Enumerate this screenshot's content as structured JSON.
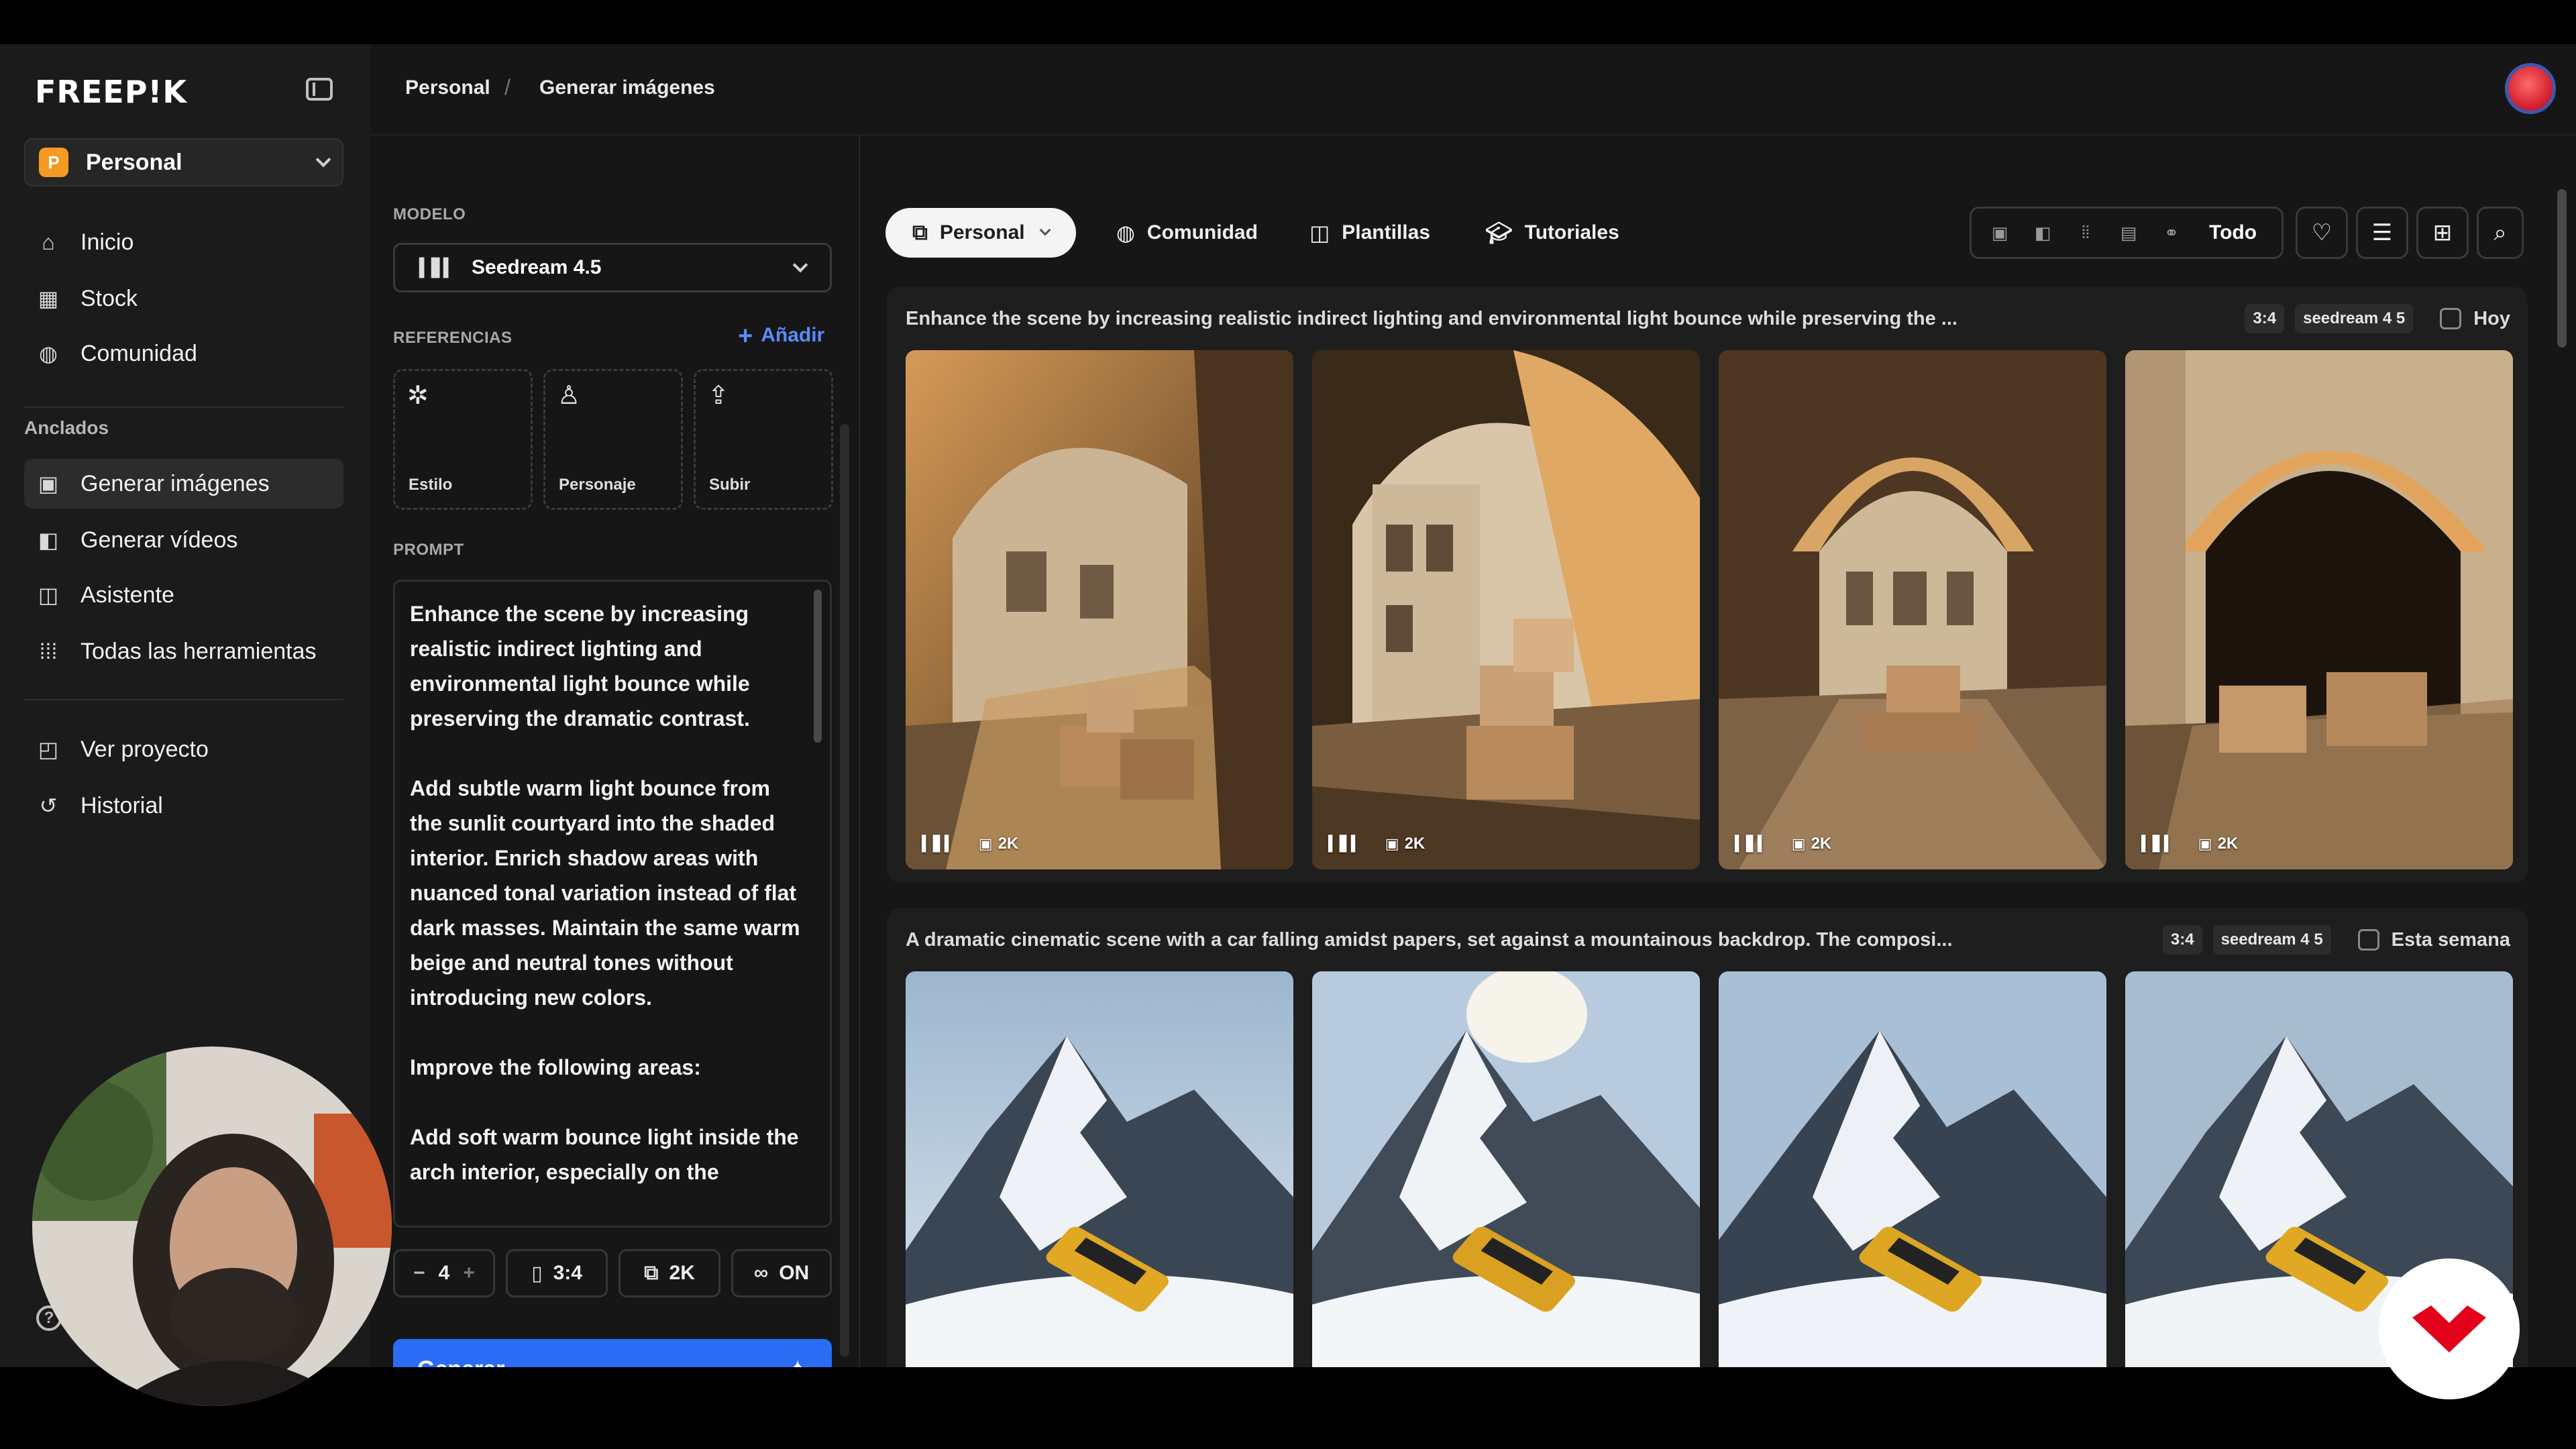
{
  "app": {
    "logo": "FREEP!K"
  },
  "sidebar": {
    "workspace": {
      "initial": "P",
      "label": "Personal"
    },
    "main_items": [
      {
        "label": "Inicio",
        "icon": "home-icon"
      },
      {
        "label": "Stock",
        "icon": "grid-icon"
      },
      {
        "label": "Comunidad",
        "icon": "globe-icon"
      }
    ],
    "pinned_title": "Anclados",
    "pinned_items": [
      {
        "label": "Generar imágenes",
        "icon": "image-icon",
        "active": true
      },
      {
        "label": "Generar vídeos",
        "icon": "video-icon"
      },
      {
        "label": "Asistente",
        "icon": "assistant-icon"
      },
      {
        "label": "Todas las herramientas",
        "icon": "apps-icon"
      }
    ],
    "project_items": [
      {
        "label": "Ver proyecto",
        "icon": "project-icon"
      },
      {
        "label": "Historial",
        "icon": "history-icon"
      }
    ]
  },
  "breadcrumb": {
    "root": "Personal",
    "sep": "/",
    "current": "Generar imágenes"
  },
  "generator": {
    "model_label": "MODELO",
    "model_value": "Seedream 4.5",
    "references_label": "REFERENCIAS",
    "add_label": "Añadir",
    "refs": [
      {
        "label": "Estilo",
        "icon": "style-icon"
      },
      {
        "label": "Personaje",
        "icon": "character-icon"
      },
      {
        "label": "Subir",
        "icon": "upload-icon"
      }
    ],
    "prompt_label": "PROMPT",
    "prompt_paragraphs": [
      "Enhance the scene by increasing realistic indirect lighting and environmental light bounce while preserving the dramatic contrast.",
      "Add subtle warm light bounce from the sunlit courtyard into the shaded interior. Enrich shadow areas with nuanced tonal variation instead of flat dark masses. Maintain the same warm beige and neutral tones without introducing new colors.",
      "Improve the following areas:",
      "Add soft warm bounce light inside the arch interior, especially on the"
    ],
    "count": {
      "minus": "−",
      "value": "4",
      "plus": "+"
    },
    "ratio": "3:4",
    "resolution": "2K",
    "loop": "ON",
    "generate_label": "Generar"
  },
  "gallery": {
    "tabs": [
      {
        "label": "Personal",
        "icon": "layers-icon",
        "active": true
      },
      {
        "label": "Comunidad",
        "icon": "globe-icon"
      },
      {
        "label": "Plantillas",
        "icon": "template-icon"
      },
      {
        "label": "Tutoriales",
        "icon": "tutorial-icon"
      }
    ],
    "filter_label": "Todo",
    "batches": [
      {
        "prompt": "Enhance the scene by increasing realistic indirect lighting and environmental light bounce while preserving the ...",
        "ratio": "3:4",
        "model": "seedream 4 5",
        "when": "Hoy",
        "thumb_meta": "2K",
        "kind": "arch"
      },
      {
        "prompt": "A dramatic cinematic scene with a car falling amidst papers, set against a mountainous backdrop. The composi...",
        "ratio": "3:4",
        "model": "seedream 4 5",
        "when": "Esta semana",
        "thumb_meta": "",
        "kind": "mountain"
      }
    ]
  },
  "colors": {
    "accent": "#2a6df4",
    "link": "#5b8cff",
    "brand_orange": "#f59a23",
    "brand_red": "#e3001b"
  }
}
